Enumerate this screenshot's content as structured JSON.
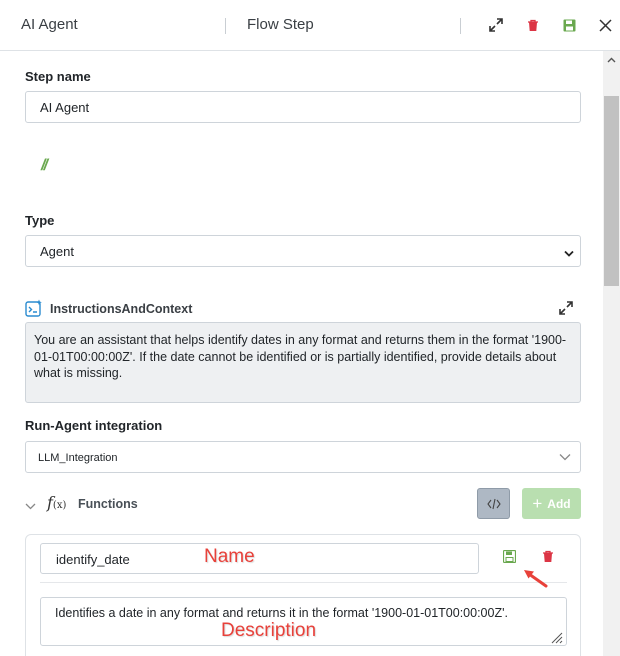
{
  "header": {
    "title": "AI Agent",
    "subtitle": "Flow Step",
    "icons": [
      "expand-icon",
      "trash-icon",
      "save-icon",
      "close-icon"
    ]
  },
  "form": {
    "step_name_label": "Step name",
    "step_name_value": "AI Agent",
    "comment_mark": "//",
    "type_label": "Type",
    "type_value": "Agent",
    "instructions_label": "InstructionsAndContext",
    "instructions_value": "You are an assistant that helps identify dates in any format and returns them in the format '1900-01-01T00:00:00Z'. If the date cannot be identified or is partially identified, provide details about what is missing.",
    "integration_label": "Run-Agent integration",
    "integration_value": "LLM_Integration"
  },
  "functions": {
    "label": "Functions",
    "add_label": "Add",
    "items": [
      {
        "name": "identify_date",
        "description": "Identifies a date in any format and returns it in the format '1900-01-01T00:00:00Z'."
      }
    ]
  },
  "annotations": {
    "name_label": "Name",
    "description_label": "Description"
  },
  "colors": {
    "accent_green": "#6aa84f",
    "danger_red": "#dc3545",
    "annotation_red": "#e8413a",
    "add_button_bg": "#b9dfb0"
  }
}
